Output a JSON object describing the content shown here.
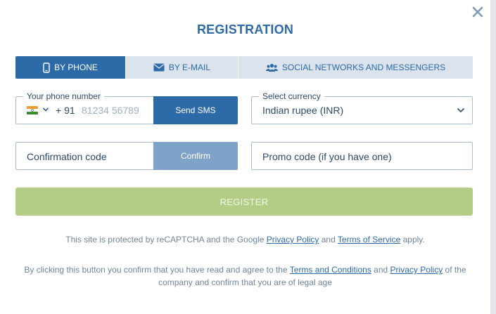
{
  "modal": {
    "title": "REGISTRATION",
    "close_icon": "close-icon"
  },
  "tabs": [
    {
      "label": "BY PHONE",
      "icon": "phone-icon",
      "active": true
    },
    {
      "label": "BY E-MAIL",
      "icon": "envelope-icon",
      "active": false
    },
    {
      "label": "SOCIAL NETWORKS AND MESSENGERS",
      "icon": "users-icon",
      "active": false
    }
  ],
  "phone": {
    "legend": "Your phone number",
    "country_flag": "india-flag-icon",
    "prefix": "+ 91",
    "placeholder": "81234 56789",
    "send_label": "Send SMS"
  },
  "currency": {
    "legend": "Select currency",
    "value": "Indian rupee (INR)"
  },
  "confirmation": {
    "placeholder": "Confirmation code",
    "button_label": "Confirm"
  },
  "promo": {
    "placeholder": "Promo code (if you have one)"
  },
  "register_label": "REGISTER",
  "recaptcha": {
    "prefix": "This site is protected by reCAPTCHA and the Google ",
    "privacy_link": "Privacy Policy",
    "and": " and ",
    "terms_link": "Terms of Service",
    "suffix": " apply."
  },
  "agreement": {
    "prefix": "By clicking this button you confirm that you have read and agree to the ",
    "terms_link": "Terms and Conditions",
    "and": " and ",
    "privacy_link": "Privacy Policy",
    "suffix": " of the company and confirm that you are of legal age"
  },
  "colors": {
    "primary": "#2d6aa8",
    "tab_bg": "#dbe3ec",
    "confirm_disabled": "#7fa3c8",
    "register_disabled": "#b3cd86",
    "text": "#2d4a6a",
    "muted": "#6f859b"
  }
}
